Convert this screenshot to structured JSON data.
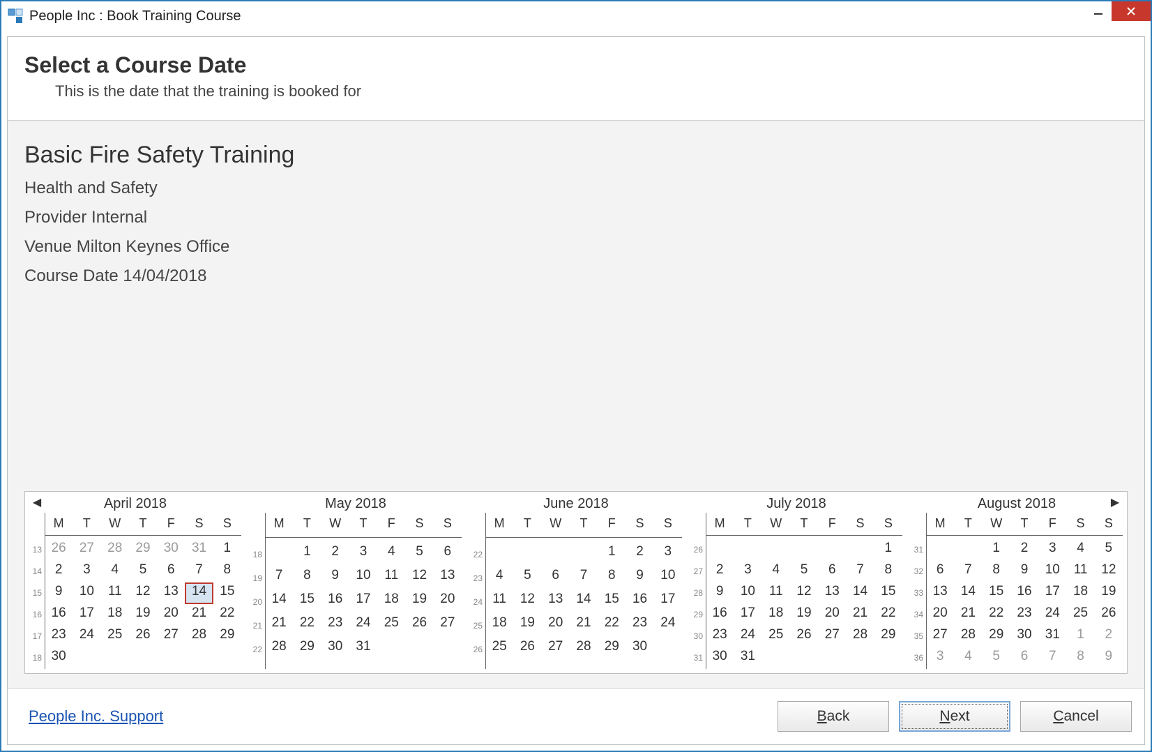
{
  "window": {
    "title": "People Inc : Book Training Course"
  },
  "header": {
    "title": "Select a Course Date",
    "subtitle": "This is the date that the training is booked for"
  },
  "course": {
    "name": "Basic Fire Safety Training",
    "category": "Health and Safety",
    "provider": "Provider Internal",
    "venue": "Venue Milton Keynes Office",
    "date_label": "Course Date 14/04/2018"
  },
  "calendar": {
    "dow": [
      "M",
      "T",
      "W",
      "T",
      "F",
      "S",
      "S"
    ],
    "months": [
      {
        "title": "April 2018",
        "weeks": [
          {
            "wk": "13",
            "days": [
              {
                "n": 26,
                "o": true
              },
              {
                "n": 27,
                "o": true
              },
              {
                "n": 28,
                "o": true
              },
              {
                "n": 29,
                "o": true
              },
              {
                "n": 30,
                "o": true
              },
              {
                "n": 31,
                "o": true
              },
              {
                "n": 1
              }
            ]
          },
          {
            "wk": "14",
            "days": [
              {
                "n": 2
              },
              {
                "n": 3
              },
              {
                "n": 4
              },
              {
                "n": 5
              },
              {
                "n": 6
              },
              {
                "n": 7
              },
              {
                "n": 8
              }
            ]
          },
          {
            "wk": "15",
            "days": [
              {
                "n": 9
              },
              {
                "n": 10
              },
              {
                "n": 11
              },
              {
                "n": 12
              },
              {
                "n": 13
              },
              {
                "n": 14,
                "sel": true
              },
              {
                "n": 15
              }
            ]
          },
          {
            "wk": "16",
            "days": [
              {
                "n": 16
              },
              {
                "n": 17
              },
              {
                "n": 18
              },
              {
                "n": 19
              },
              {
                "n": 20
              },
              {
                "n": 21
              },
              {
                "n": 22
              }
            ]
          },
          {
            "wk": "17",
            "days": [
              {
                "n": 23
              },
              {
                "n": 24
              },
              {
                "n": 25
              },
              {
                "n": 26
              },
              {
                "n": 27
              },
              {
                "n": 28
              },
              {
                "n": 29
              }
            ]
          },
          {
            "wk": "18",
            "days": [
              {
                "n": 30
              },
              {
                "n": "",
                "o": true
              },
              {
                "n": "",
                "o": true
              },
              {
                "n": "",
                "o": true
              },
              {
                "n": "",
                "o": true
              },
              {
                "n": "",
                "o": true
              },
              {
                "n": "",
                "o": true
              }
            ]
          }
        ]
      },
      {
        "title": "May 2018",
        "weeks": [
          {
            "wk": "18",
            "days": [
              {
                "n": "",
                "o": true
              },
              {
                "n": 1
              },
              {
                "n": 2
              },
              {
                "n": 3
              },
              {
                "n": 4
              },
              {
                "n": 5
              },
              {
                "n": 6
              }
            ]
          },
          {
            "wk": "19",
            "days": [
              {
                "n": 7
              },
              {
                "n": 8
              },
              {
                "n": 9
              },
              {
                "n": 10
              },
              {
                "n": 11
              },
              {
                "n": 12
              },
              {
                "n": 13
              }
            ]
          },
          {
            "wk": "20",
            "days": [
              {
                "n": 14
              },
              {
                "n": 15
              },
              {
                "n": 16
              },
              {
                "n": 17
              },
              {
                "n": 18
              },
              {
                "n": 19
              },
              {
                "n": 20
              }
            ]
          },
          {
            "wk": "21",
            "days": [
              {
                "n": 21
              },
              {
                "n": 22
              },
              {
                "n": 23
              },
              {
                "n": 24
              },
              {
                "n": 25
              },
              {
                "n": 26
              },
              {
                "n": 27
              }
            ]
          },
          {
            "wk": "22",
            "days": [
              {
                "n": 28
              },
              {
                "n": 29
              },
              {
                "n": 30
              },
              {
                "n": 31
              },
              {
                "n": "",
                "o": true
              },
              {
                "n": "",
                "o": true
              },
              {
                "n": "",
                "o": true
              }
            ]
          },
          {
            "wk": "",
            "days": [
              {
                "n": "",
                "o": true
              },
              {
                "n": "",
                "o": true
              },
              {
                "n": "",
                "o": true
              },
              {
                "n": "",
                "o": true
              },
              {
                "n": "",
                "o": true
              },
              {
                "n": "",
                "o": true
              },
              {
                "n": "",
                "o": true
              }
            ]
          }
        ]
      },
      {
        "title": "June 2018",
        "weeks": [
          {
            "wk": "22",
            "days": [
              {
                "n": "",
                "o": true
              },
              {
                "n": "",
                "o": true
              },
              {
                "n": "",
                "o": true
              },
              {
                "n": "",
                "o": true
              },
              {
                "n": 1
              },
              {
                "n": 2
              },
              {
                "n": 3
              }
            ]
          },
          {
            "wk": "23",
            "days": [
              {
                "n": 4
              },
              {
                "n": 5
              },
              {
                "n": 6
              },
              {
                "n": 7
              },
              {
                "n": 8
              },
              {
                "n": 9
              },
              {
                "n": 10
              }
            ]
          },
          {
            "wk": "24",
            "days": [
              {
                "n": 11
              },
              {
                "n": 12
              },
              {
                "n": 13
              },
              {
                "n": 14
              },
              {
                "n": 15
              },
              {
                "n": 16
              },
              {
                "n": 17
              }
            ]
          },
          {
            "wk": "25",
            "days": [
              {
                "n": 18
              },
              {
                "n": 19
              },
              {
                "n": 20
              },
              {
                "n": 21
              },
              {
                "n": 22
              },
              {
                "n": 23
              },
              {
                "n": 24
              }
            ]
          },
          {
            "wk": "26",
            "days": [
              {
                "n": 25
              },
              {
                "n": 26
              },
              {
                "n": 27
              },
              {
                "n": 28
              },
              {
                "n": 29
              },
              {
                "n": 30
              },
              {
                "n": "",
                "o": true
              }
            ]
          },
          {
            "wk": "",
            "days": [
              {
                "n": "",
                "o": true
              },
              {
                "n": "",
                "o": true
              },
              {
                "n": "",
                "o": true
              },
              {
                "n": "",
                "o": true
              },
              {
                "n": "",
                "o": true
              },
              {
                "n": "",
                "o": true
              },
              {
                "n": "",
                "o": true
              }
            ]
          }
        ]
      },
      {
        "title": "July 2018",
        "weeks": [
          {
            "wk": "26",
            "days": [
              {
                "n": "",
                "o": true
              },
              {
                "n": "",
                "o": true
              },
              {
                "n": "",
                "o": true
              },
              {
                "n": "",
                "o": true
              },
              {
                "n": "",
                "o": true
              },
              {
                "n": "",
                "o": true
              },
              {
                "n": 1
              }
            ]
          },
          {
            "wk": "27",
            "days": [
              {
                "n": 2
              },
              {
                "n": 3
              },
              {
                "n": 4
              },
              {
                "n": 5
              },
              {
                "n": 6
              },
              {
                "n": 7
              },
              {
                "n": 8
              }
            ]
          },
          {
            "wk": "28",
            "days": [
              {
                "n": 9
              },
              {
                "n": 10
              },
              {
                "n": 11
              },
              {
                "n": 12
              },
              {
                "n": 13
              },
              {
                "n": 14
              },
              {
                "n": 15
              }
            ]
          },
          {
            "wk": "29",
            "days": [
              {
                "n": 16
              },
              {
                "n": 17
              },
              {
                "n": 18
              },
              {
                "n": 19
              },
              {
                "n": 20
              },
              {
                "n": 21
              },
              {
                "n": 22
              }
            ]
          },
          {
            "wk": "30",
            "days": [
              {
                "n": 23
              },
              {
                "n": 24
              },
              {
                "n": 25
              },
              {
                "n": 26
              },
              {
                "n": 27
              },
              {
                "n": 28
              },
              {
                "n": 29
              }
            ]
          },
          {
            "wk": "31",
            "days": [
              {
                "n": 30
              },
              {
                "n": 31
              },
              {
                "n": "",
                "o": true
              },
              {
                "n": "",
                "o": true
              },
              {
                "n": "",
                "o": true
              },
              {
                "n": "",
                "o": true
              },
              {
                "n": "",
                "o": true
              }
            ]
          }
        ]
      },
      {
        "title": "August 2018",
        "weeks": [
          {
            "wk": "31",
            "days": [
              {
                "n": "",
                "o": true
              },
              {
                "n": "",
                "o": true
              },
              {
                "n": 1
              },
              {
                "n": 2
              },
              {
                "n": 3
              },
              {
                "n": 4
              },
              {
                "n": 5
              }
            ]
          },
          {
            "wk": "32",
            "days": [
              {
                "n": 6
              },
              {
                "n": 7
              },
              {
                "n": 8
              },
              {
                "n": 9
              },
              {
                "n": 10
              },
              {
                "n": 11
              },
              {
                "n": 12
              }
            ]
          },
          {
            "wk": "33",
            "days": [
              {
                "n": 13
              },
              {
                "n": 14
              },
              {
                "n": 15
              },
              {
                "n": 16
              },
              {
                "n": 17
              },
              {
                "n": 18
              },
              {
                "n": 19
              }
            ]
          },
          {
            "wk": "34",
            "days": [
              {
                "n": 20
              },
              {
                "n": 21
              },
              {
                "n": 22
              },
              {
                "n": 23
              },
              {
                "n": 24
              },
              {
                "n": 25
              },
              {
                "n": 26
              }
            ]
          },
          {
            "wk": "35",
            "days": [
              {
                "n": 27
              },
              {
                "n": 28
              },
              {
                "n": 29
              },
              {
                "n": 30
              },
              {
                "n": 31
              },
              {
                "n": 1,
                "o": true
              },
              {
                "n": 2,
                "o": true
              }
            ]
          },
          {
            "wk": "36",
            "days": [
              {
                "n": 3,
                "o": true
              },
              {
                "n": 4,
                "o": true
              },
              {
                "n": 5,
                "o": true
              },
              {
                "n": 6,
                "o": true
              },
              {
                "n": 7,
                "o": true
              },
              {
                "n": 8,
                "o": true
              },
              {
                "n": 9,
                "o": true
              }
            ]
          }
        ]
      }
    ]
  },
  "footer": {
    "support_link": "People Inc. Support",
    "back": "Back",
    "next": "Next",
    "cancel": "Cancel"
  }
}
